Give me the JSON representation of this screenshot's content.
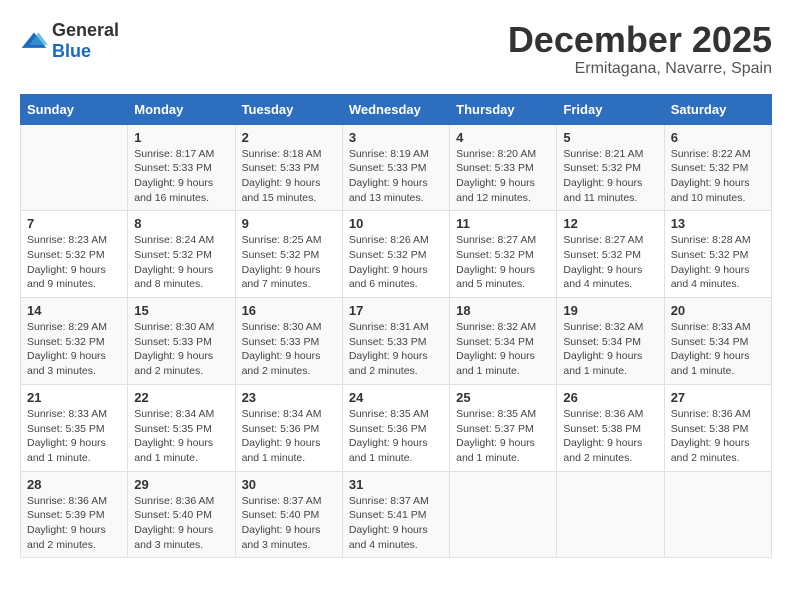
{
  "header": {
    "logo_general": "General",
    "logo_blue": "Blue",
    "title": "December 2025",
    "subtitle": "Ermitagana, Navarre, Spain"
  },
  "weekdays": [
    "Sunday",
    "Monday",
    "Tuesday",
    "Wednesday",
    "Thursday",
    "Friday",
    "Saturday"
  ],
  "weeks": [
    [
      {
        "day": "",
        "info": ""
      },
      {
        "day": "1",
        "info": "Sunrise: 8:17 AM\nSunset: 5:33 PM\nDaylight: 9 hours\nand 16 minutes."
      },
      {
        "day": "2",
        "info": "Sunrise: 8:18 AM\nSunset: 5:33 PM\nDaylight: 9 hours\nand 15 minutes."
      },
      {
        "day": "3",
        "info": "Sunrise: 8:19 AM\nSunset: 5:33 PM\nDaylight: 9 hours\nand 13 minutes."
      },
      {
        "day": "4",
        "info": "Sunrise: 8:20 AM\nSunset: 5:33 PM\nDaylight: 9 hours\nand 12 minutes."
      },
      {
        "day": "5",
        "info": "Sunrise: 8:21 AM\nSunset: 5:32 PM\nDaylight: 9 hours\nand 11 minutes."
      },
      {
        "day": "6",
        "info": "Sunrise: 8:22 AM\nSunset: 5:32 PM\nDaylight: 9 hours\nand 10 minutes."
      }
    ],
    [
      {
        "day": "7",
        "info": "Sunrise: 8:23 AM\nSunset: 5:32 PM\nDaylight: 9 hours\nand 9 minutes."
      },
      {
        "day": "8",
        "info": "Sunrise: 8:24 AM\nSunset: 5:32 PM\nDaylight: 9 hours\nand 8 minutes."
      },
      {
        "day": "9",
        "info": "Sunrise: 8:25 AM\nSunset: 5:32 PM\nDaylight: 9 hours\nand 7 minutes."
      },
      {
        "day": "10",
        "info": "Sunrise: 8:26 AM\nSunset: 5:32 PM\nDaylight: 9 hours\nand 6 minutes."
      },
      {
        "day": "11",
        "info": "Sunrise: 8:27 AM\nSunset: 5:32 PM\nDaylight: 9 hours\nand 5 minutes."
      },
      {
        "day": "12",
        "info": "Sunrise: 8:27 AM\nSunset: 5:32 PM\nDaylight: 9 hours\nand 4 minutes."
      },
      {
        "day": "13",
        "info": "Sunrise: 8:28 AM\nSunset: 5:32 PM\nDaylight: 9 hours\nand 4 minutes."
      }
    ],
    [
      {
        "day": "14",
        "info": "Sunrise: 8:29 AM\nSunset: 5:32 PM\nDaylight: 9 hours\nand 3 minutes."
      },
      {
        "day": "15",
        "info": "Sunrise: 8:30 AM\nSunset: 5:33 PM\nDaylight: 9 hours\nand 2 minutes."
      },
      {
        "day": "16",
        "info": "Sunrise: 8:30 AM\nSunset: 5:33 PM\nDaylight: 9 hours\nand 2 minutes."
      },
      {
        "day": "17",
        "info": "Sunrise: 8:31 AM\nSunset: 5:33 PM\nDaylight: 9 hours\nand 2 minutes."
      },
      {
        "day": "18",
        "info": "Sunrise: 8:32 AM\nSunset: 5:34 PM\nDaylight: 9 hours\nand 1 minute."
      },
      {
        "day": "19",
        "info": "Sunrise: 8:32 AM\nSunset: 5:34 PM\nDaylight: 9 hours\nand 1 minute."
      },
      {
        "day": "20",
        "info": "Sunrise: 8:33 AM\nSunset: 5:34 PM\nDaylight: 9 hours\nand 1 minute."
      }
    ],
    [
      {
        "day": "21",
        "info": "Sunrise: 8:33 AM\nSunset: 5:35 PM\nDaylight: 9 hours\nand 1 minute."
      },
      {
        "day": "22",
        "info": "Sunrise: 8:34 AM\nSunset: 5:35 PM\nDaylight: 9 hours\nand 1 minute."
      },
      {
        "day": "23",
        "info": "Sunrise: 8:34 AM\nSunset: 5:36 PM\nDaylight: 9 hours\nand 1 minute."
      },
      {
        "day": "24",
        "info": "Sunrise: 8:35 AM\nSunset: 5:36 PM\nDaylight: 9 hours\nand 1 minute."
      },
      {
        "day": "25",
        "info": "Sunrise: 8:35 AM\nSunset: 5:37 PM\nDaylight: 9 hours\nand 1 minute."
      },
      {
        "day": "26",
        "info": "Sunrise: 8:36 AM\nSunset: 5:38 PM\nDaylight: 9 hours\nand 2 minutes."
      },
      {
        "day": "27",
        "info": "Sunrise: 8:36 AM\nSunset: 5:38 PM\nDaylight: 9 hours\nand 2 minutes."
      }
    ],
    [
      {
        "day": "28",
        "info": "Sunrise: 8:36 AM\nSunset: 5:39 PM\nDaylight: 9 hours\nand 2 minutes."
      },
      {
        "day": "29",
        "info": "Sunrise: 8:36 AM\nSunset: 5:40 PM\nDaylight: 9 hours\nand 3 minutes."
      },
      {
        "day": "30",
        "info": "Sunrise: 8:37 AM\nSunset: 5:40 PM\nDaylight: 9 hours\nand 3 minutes."
      },
      {
        "day": "31",
        "info": "Sunrise: 8:37 AM\nSunset: 5:41 PM\nDaylight: 9 hours\nand 4 minutes."
      },
      {
        "day": "",
        "info": ""
      },
      {
        "day": "",
        "info": ""
      },
      {
        "day": "",
        "info": ""
      }
    ]
  ]
}
